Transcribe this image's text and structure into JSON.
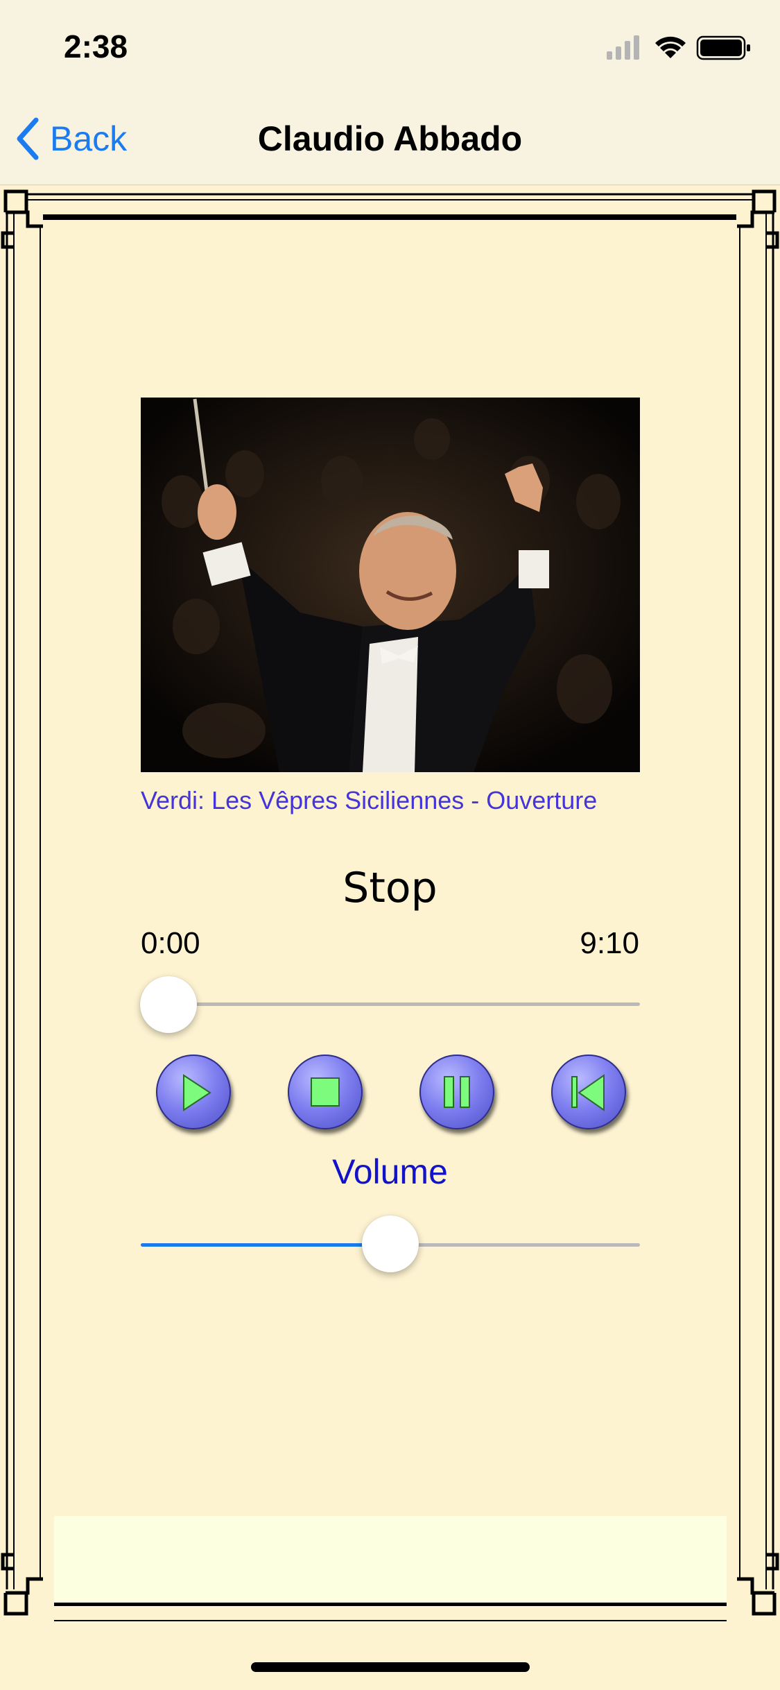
{
  "status_bar": {
    "time": "2:38"
  },
  "nav": {
    "back_label": "Back",
    "title": "Claudio Abbado"
  },
  "player": {
    "track_title": "Verdi: Les Vêpres Siciliennes - Ouverture",
    "state": "Stop",
    "elapsed": "0:00",
    "duration": "9:10",
    "progress_fraction": 0.0,
    "volume_label": "Volume",
    "volume_fraction": 0.5
  },
  "controls": [
    "play-icon",
    "stop-icon",
    "pause-icon",
    "skip-back-icon"
  ],
  "colors": {
    "background": "#fdf3d1",
    "accent_blue": "#1a7cf0",
    "title_purple": "#4535d8",
    "volume_blue": "#1212c8",
    "button_blue": "#7f7ff0",
    "button_icon_green": "#7dfb7d"
  }
}
